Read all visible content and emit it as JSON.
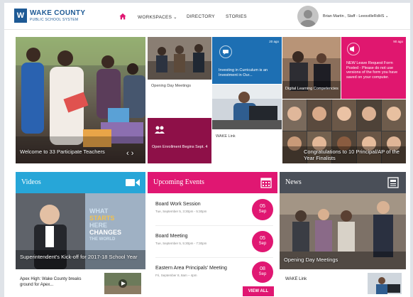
{
  "header": {
    "logo_mark": "W",
    "logo_title": "WAKE COUNTY",
    "logo_subtitle": "PUBLIC SCHOOL SYSTEM",
    "nav": [
      "WORKSPACES ⌄",
      "DIRECTORY",
      "STORIES"
    ],
    "user": "Brian Martin , Staff - LeesvilleRdHS ⌄"
  },
  "hero": {
    "caption": "Welcome to 33 Participate Teachers",
    "controls": "‹ ›"
  },
  "tiles": {
    "opening_day": "Opening Day Meetings",
    "curriculum": {
      "ago": "20 ago",
      "text": "Investing in Curriculum is an Investment in Our..."
    },
    "open_enrollment": "Open Enrollment Begins Sept. 4",
    "wake_link": "WAKE Link",
    "digital": "Digital Learning Competencies",
    "leave_request": {
      "ago": "90 ago",
      "text": "NEW Leave Request Form Posted - Please do not use versions of the form you have saved on your computer."
    },
    "finalists": "Congratulations to 10 Principal/AP of the Year Finalists"
  },
  "videos": {
    "title": "Videos",
    "overlay_lines": [
      "WHAT",
      "STARTS",
      "HERE",
      "CHANGES",
      "THE WORLD"
    ],
    "feature_caption": "Superintendent's Kick-off for 2017-18 School Year",
    "item": "Apex High: Wake County breaks ground for Apex..."
  },
  "events": {
    "title": "Upcoming Events",
    "items": [
      {
        "title": "Board Work Session",
        "sub": "Tue, September 5, 3:30pm - 5:30pm",
        "day": "05",
        "mon": "Sep"
      },
      {
        "title": "Board Meeting",
        "sub": "Tue, September 5, 5:30pm - 7:30pm",
        "day": "05",
        "mon": "Sep"
      },
      {
        "title": "Eastern Area Principals' Meeting",
        "sub": "Fri, September 8, 8am – 4pm",
        "day": "08",
        "mon": "Sep"
      }
    ],
    "view_all": "VIEW ALL"
  },
  "news": {
    "title": "News",
    "feature_caption": "Opening Day Meetings",
    "item": "WAKE Link"
  },
  "colors": {
    "brand_blue": "#1e5a95",
    "events_pink": "#e01772",
    "videos_blue": "#27a6d8",
    "news_gray": "#4a4f58",
    "tile_blue": "#1d6fb3"
  }
}
